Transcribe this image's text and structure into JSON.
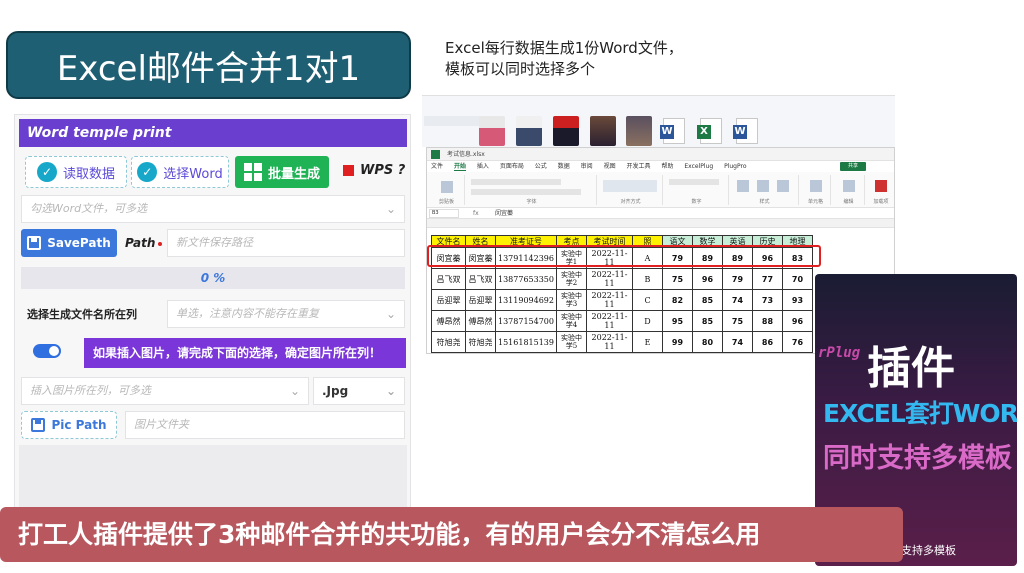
{
  "title": "Excel邮件合并1对1",
  "description": [
    "Excel每行数据生成1份Word文件，",
    "模板可以同时选择多个"
  ],
  "panel": {
    "header": "Word temple print",
    "read_data": "读取数据",
    "select_word": "选择Word",
    "batch_generate": "批量生成",
    "wps_label": "WPS ?",
    "word_select_placeholder": "勾选Word文件，可多选",
    "save_path_button": "SavePath",
    "path_label": "Path",
    "save_path_placeholder": "新文件保存路径",
    "progress": "0 %",
    "name_col_label": "选择生成文件名所在列",
    "name_col_placeholder": "单选，注意内容不能存在重复",
    "insert_pic_note": "如果插入图片，请完成下面的选择，确定图片所在列！",
    "pic_col_placeholder": "插入图片所在列，可多选",
    "ext_value": ".Jpg",
    "pic_path_button": "Pic Path",
    "pic_folder_placeholder": "图片文件夹"
  },
  "excel": {
    "window_title": "考试信息.xlsx",
    "menu": [
      "文件",
      "开始",
      "插入",
      "页面布局",
      "公式",
      "数据",
      "审阅",
      "视图",
      "开发工具",
      "帮助",
      "ExcelPlug",
      "PlugPro"
    ],
    "active_menu": "开始",
    "share_label": "共享",
    "name_box": "B3",
    "fx": "fx",
    "formula_value": "闵宜蓁",
    "ribbon_groups": [
      "剪贴板",
      "字体",
      "对齐方式",
      "数字",
      "样式",
      "单元格",
      "编辑",
      "加载项"
    ],
    "columns": [
      "文件名",
      "姓名",
      "准考证号",
      "考点",
      "考试时间",
      "照",
      "语文",
      "数学",
      "英语",
      "历史",
      "地理"
    ],
    "rows": [
      [
        "闵宜蓁",
        "闵宜蓁",
        "13791142396",
        "实验中学1",
        "2022-11-11",
        "A",
        "79",
        "89",
        "89",
        "96",
        "83"
      ],
      [
        "吕飞双",
        "吕飞双",
        "13877653350",
        "实验中学2",
        "2022-11-11",
        "B",
        "75",
        "96",
        "79",
        "77",
        "70"
      ],
      [
        "岳迎翠",
        "岳迎翠",
        "13119094692",
        "实验中学3",
        "2022-11-11",
        "C",
        "82",
        "85",
        "74",
        "73",
        "93"
      ],
      [
        "傅昂然",
        "傅昂然",
        "13787154700",
        "实验中学4",
        "2022-11-11",
        "D",
        "95",
        "85",
        "75",
        "88",
        "96"
      ],
      [
        "符旭尧",
        "符旭尧",
        "15161815139",
        "实验中学5",
        "2022-11-11",
        "E",
        "99",
        "80",
        "74",
        "86",
        "76"
      ]
    ]
  },
  "promo": {
    "plug_fragment": "rPlug",
    "plugin": "插件",
    "line1": "EXCEL套打WORD",
    "line2": "同时支持多模板",
    "footer": "支持多模板"
  },
  "subtitle": "打工人插件提供了3种邮件合并的共功能，有的用户会分不清怎么用",
  "colors": {
    "banner": "#1f5f73",
    "panel_header": "#6a3fd0",
    "green_button": "#1fb356",
    "blue_button": "#3c78dc",
    "note_purple": "#7a36d8",
    "subtitle_bg": "#b8585e",
    "highlight_red": "#e02020"
  }
}
